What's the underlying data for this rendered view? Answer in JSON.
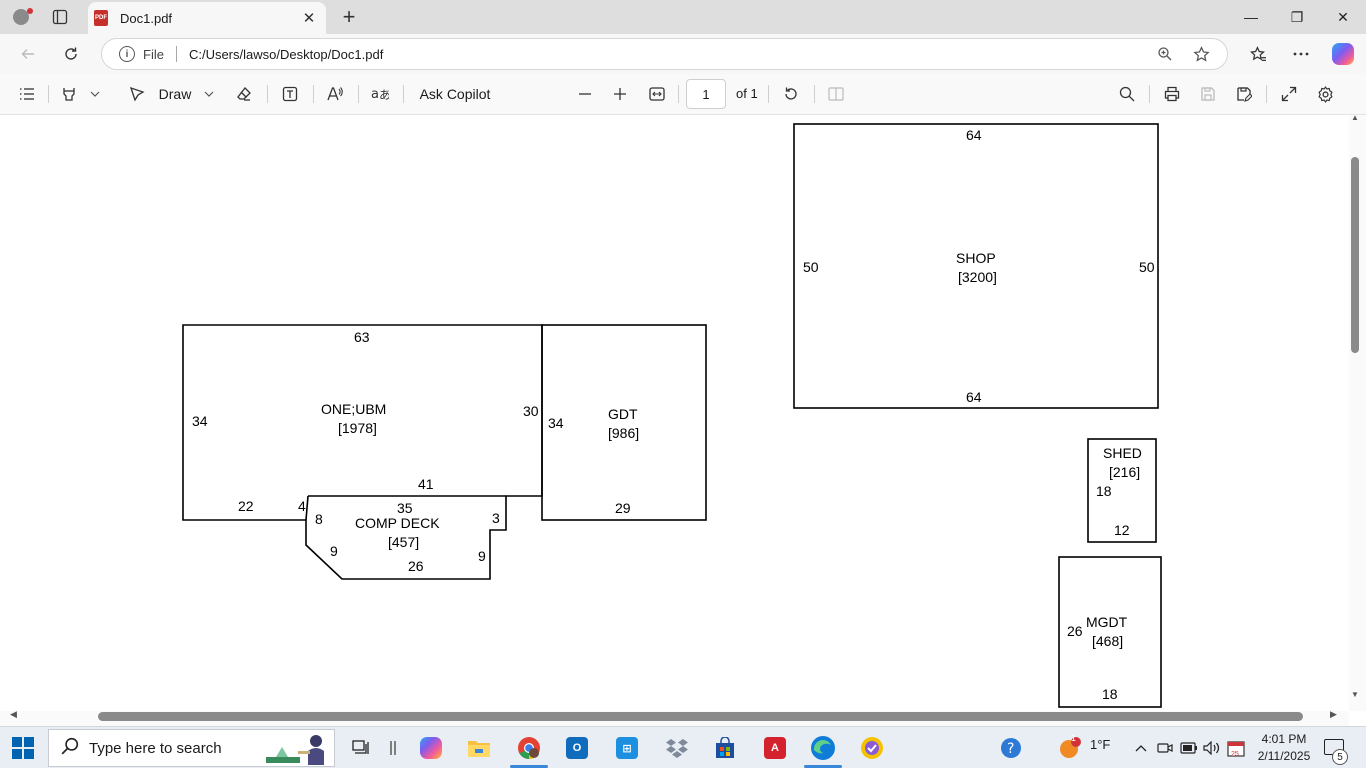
{
  "browser": {
    "tab_title": "Doc1.pdf",
    "tab_close": "✕",
    "new_tab": "+",
    "window_controls": [
      "—",
      "❐",
      "✕"
    ],
    "address": {
      "scheme_label": "File",
      "url": "C:/Users/lawso/Desktop/Doc1.pdf"
    }
  },
  "pdf_toolbar": {
    "draw_label": "Draw",
    "ask_copilot_label": "Ask Copilot",
    "page_current": "1",
    "page_total_label": "of 1",
    "icons": [
      "contents-icon",
      "highlight-icon",
      "draw-icon",
      "eraser-icon",
      "text-box-icon",
      "read-aloud-icon",
      "translate-icon",
      "zoom-out-icon",
      "zoom-in-icon",
      "fit-page-icon",
      "rotate-icon",
      "page-view-icon",
      "search-icon",
      "print-icon",
      "save-icon",
      "save-as-icon",
      "fullscreen-icon",
      "settings-icon"
    ]
  },
  "sketch": {
    "main": {
      "name": "ONE;UBM",
      "area": "[1978]",
      "dims": [
        "63",
        "34",
        "30",
        "22",
        "4",
        "41"
      ]
    },
    "garage": {
      "name": "GDT",
      "area": "[986]",
      "dims": [
        "34",
        "29"
      ]
    },
    "deck": {
      "name": "COMP DECK",
      "area": "[457]",
      "dims": [
        "35",
        "8",
        "9",
        "26",
        "9",
        "3"
      ]
    },
    "shop": {
      "name": "SHOP",
      "area": "[3200]",
      "dims": [
        "64",
        "50",
        "50",
        "64"
      ]
    },
    "shed": {
      "name": "SHED",
      "area": "[216]",
      "dims": [
        "18",
        "12"
      ]
    },
    "mgdt": {
      "name": "MGDT",
      "area": "[468]",
      "dims": [
        "26",
        "18"
      ]
    }
  },
  "taskbar": {
    "search_placeholder": "Type here to search",
    "weather_temp": "1°F",
    "weather_badge": "1",
    "calendar_badge": "25",
    "time": "4:01 PM",
    "date": "2/11/2025",
    "notification_count": "5",
    "apps": [
      "task-view-icon",
      "copilot-icon",
      "file-explorer-icon",
      "chrome-icon",
      "outlook-icon",
      "network-app-icon",
      "dropbox-icon",
      "store-icon",
      "acrobat-icon",
      "edge-icon",
      "norton-icon"
    ]
  }
}
